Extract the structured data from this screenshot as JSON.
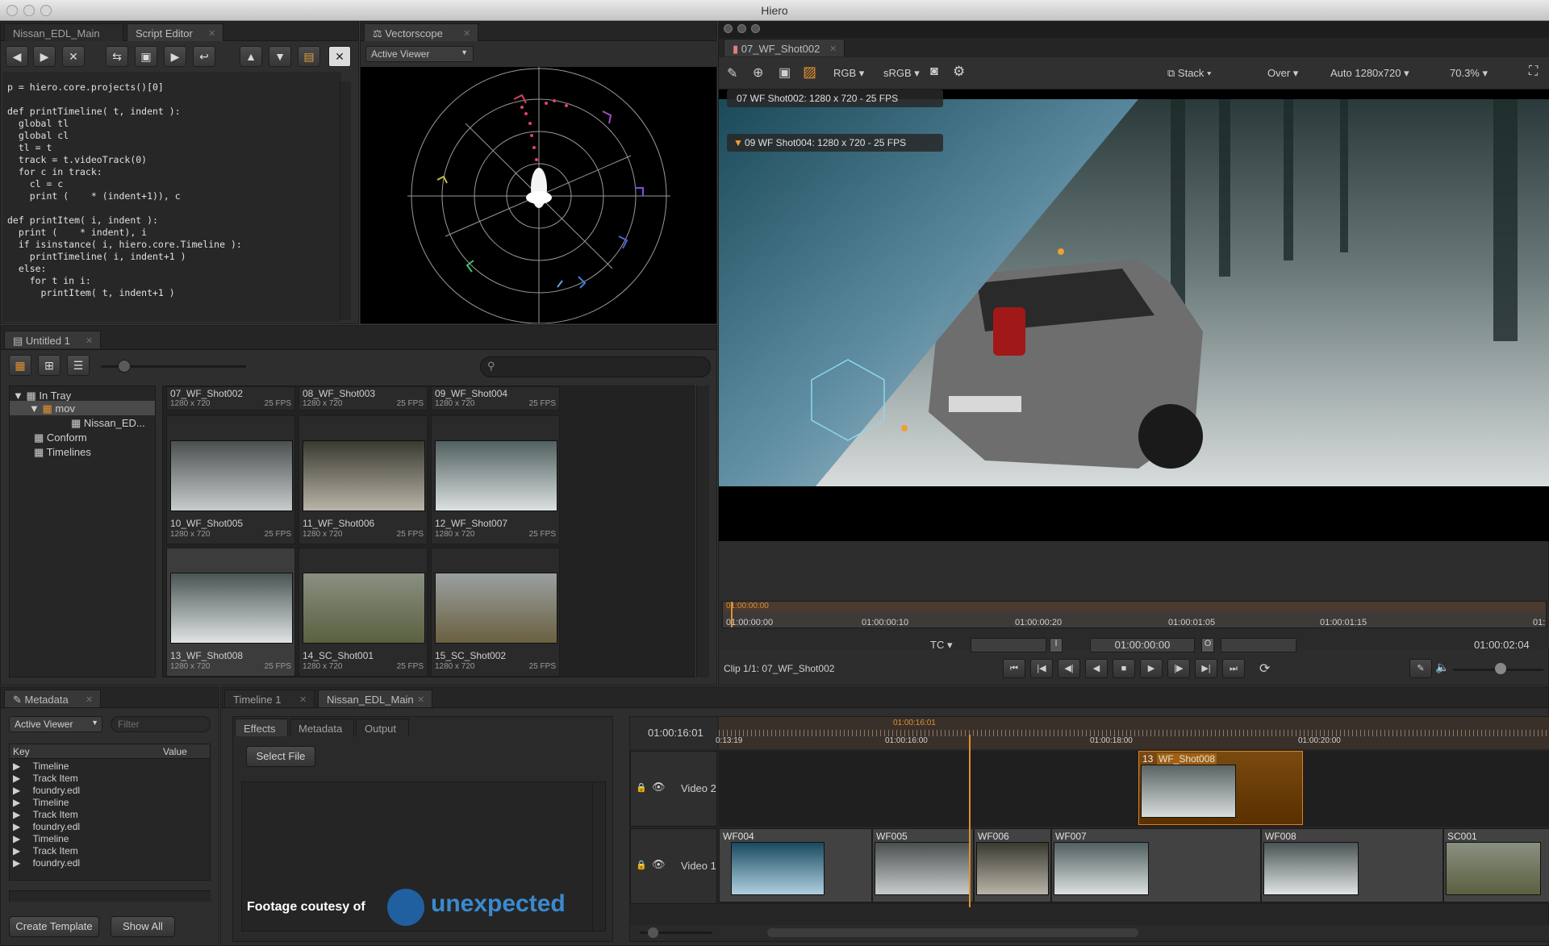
{
  "window": {
    "title": "Hiero"
  },
  "script_panel": {
    "tabs": [
      "Nissan_EDL_Main",
      "Script Editor"
    ],
    "code": "p = hiero.core.projects()[0]\n\ndef printTimeline( t, indent ):\n  global tl\n  global cl\n  tl = t\n  track = t.videoTrack(0)\n  for c in track:\n    cl = c\n    print (    * (indent+1)), c\n\ndef printItem( i, indent ):\n  print (    * indent), i\n  if isinstance( i, hiero.core.Timeline ):\n    printTimeline( i, indent+1 )\n  else:\n    for t in i:\n      printItem( t, indent+1 )"
  },
  "vectorscope": {
    "tab": "Vectorscope",
    "dropdown": "Active Viewer"
  },
  "viewer": {
    "tab": "07_WF_Shot002",
    "toolbar": {
      "channels": "RGB",
      "lut": "sRGB",
      "mode": "Stack",
      "comp": "Over",
      "res": "Auto 1280x720",
      "zoom": "70.3%"
    },
    "overlay_a": "07 WF Shot002: 1280 x 720 - 25 FPS",
    "overlay_b": "09 WF Shot004: 1280 x 720 - 25 FPS",
    "ruler_tc": [
      "01:00:00:00",
      "01:00:00:10",
      "01:00:00:20",
      "01:00:01:05",
      "01:00:01:15",
      "01:"
    ],
    "ruler_top": "01:00:00:00",
    "tc_mode": "TC",
    "in_marker": "I",
    "out_marker": "O",
    "current_tc": "01:00:00:00",
    "duration_tc": "01:00:02:04",
    "clip_info": "Clip 1/1: 07_WF_Shot002"
  },
  "bin": {
    "tab": "Untitled 1",
    "tree": [
      "In Tray",
      "mov",
      "Nissan_ED...",
      "Conform",
      "Timelines"
    ],
    "items": [
      {
        "name": "07_WF_Shot002",
        "size": "1280 x 720",
        "fps": "25 FPS"
      },
      {
        "name": "08_WF_Shot003",
        "size": "1280 x 720",
        "fps": "25 FPS"
      },
      {
        "name": "09_WF_Shot004",
        "size": "1280 x 720",
        "fps": "25 FPS"
      },
      {
        "name": "10_WF_Shot005",
        "size": "1280 x 720",
        "fps": "25 FPS"
      },
      {
        "name": "11_WF_Shot006",
        "size": "1280 x 720",
        "fps": "25 FPS"
      },
      {
        "name": "12_WF_Shot007",
        "size": "1280 x 720",
        "fps": "25 FPS"
      },
      {
        "name": "13_WF_Shot008",
        "size": "1280 x 720",
        "fps": "25 FPS"
      },
      {
        "name": "14_SC_Shot001",
        "size": "1280 x 720",
        "fps": "25 FPS"
      },
      {
        "name": "15_SC_Shot002",
        "size": "1280 x 720",
        "fps": "25 FPS"
      }
    ]
  },
  "metadata_panel": {
    "tab": "Metadata",
    "dropdown": "Active Viewer",
    "filter_placeholder": "Filter",
    "col_key": "Key",
    "col_value": "Value",
    "rows": [
      "Timeline",
      "Track Item",
      "foundry.edl",
      "Timeline",
      "Track Item",
      "foundry.edl",
      "Timeline",
      "Track Item",
      "foundry.edl"
    ],
    "create_template": "Create Template",
    "show_all": "Show All"
  },
  "timeline_panel": {
    "tabs": [
      "Timeline 1",
      "Nissan_EDL_Main"
    ],
    "subtabs": [
      "Effects",
      "Metadata",
      "Output"
    ],
    "select_file": "Select File",
    "credit": "Footage coutesy of",
    "logo": "unexpected",
    "current_tc": "01:00:16:01",
    "playhead_tc": "01:00:16:01",
    "ruler": [
      "0:13:19",
      "01:00:16:00",
      "01:00:18:00",
      "01:00:20:00"
    ],
    "tracks": [
      "Video 2",
      "Video 1"
    ],
    "v2_clip": {
      "num": "13",
      "name": "WF_Shot008"
    },
    "v1_clips": [
      "WF004",
      "WF005",
      "WF006",
      "WF007",
      "WF008",
      "SC001"
    ]
  }
}
